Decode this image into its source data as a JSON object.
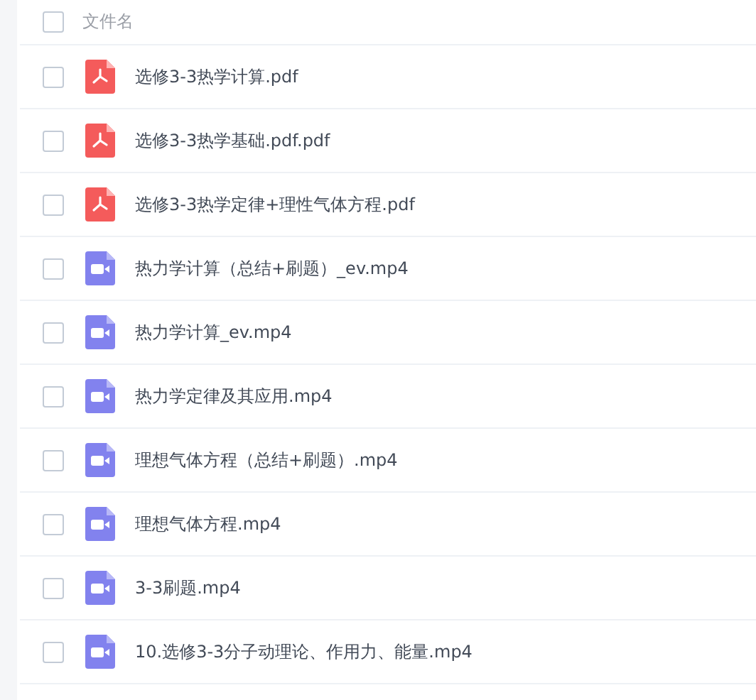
{
  "header": {
    "label": "文件名",
    "checked": false
  },
  "files": [
    {
      "name": "选修3-3热学计算.pdf",
      "kind": "pdf",
      "checked": false
    },
    {
      "name": "选修3-3热学基础.pdf.pdf",
      "kind": "pdf",
      "checked": false
    },
    {
      "name": "选修3-3热学定律+理性气体方程.pdf",
      "kind": "pdf",
      "checked": false
    },
    {
      "name": "热力学计算（总结+刷题）_ev.mp4",
      "kind": "video",
      "checked": false
    },
    {
      "name": "热力学计算_ev.mp4",
      "kind": "video",
      "checked": false
    },
    {
      "name": "热力学定律及其应用.mp4",
      "kind": "video",
      "checked": false
    },
    {
      "name": "理想气体方程（总结+刷题）.mp4",
      "kind": "video",
      "checked": false
    },
    {
      "name": "理想气体方程.mp4",
      "kind": "video",
      "checked": false
    },
    {
      "name": "3-3刷题.mp4",
      "kind": "video",
      "checked": false
    },
    {
      "name": "10.选修3-3分子动理论、作用力、能量.mp4",
      "kind": "video",
      "checked": false
    }
  ]
}
